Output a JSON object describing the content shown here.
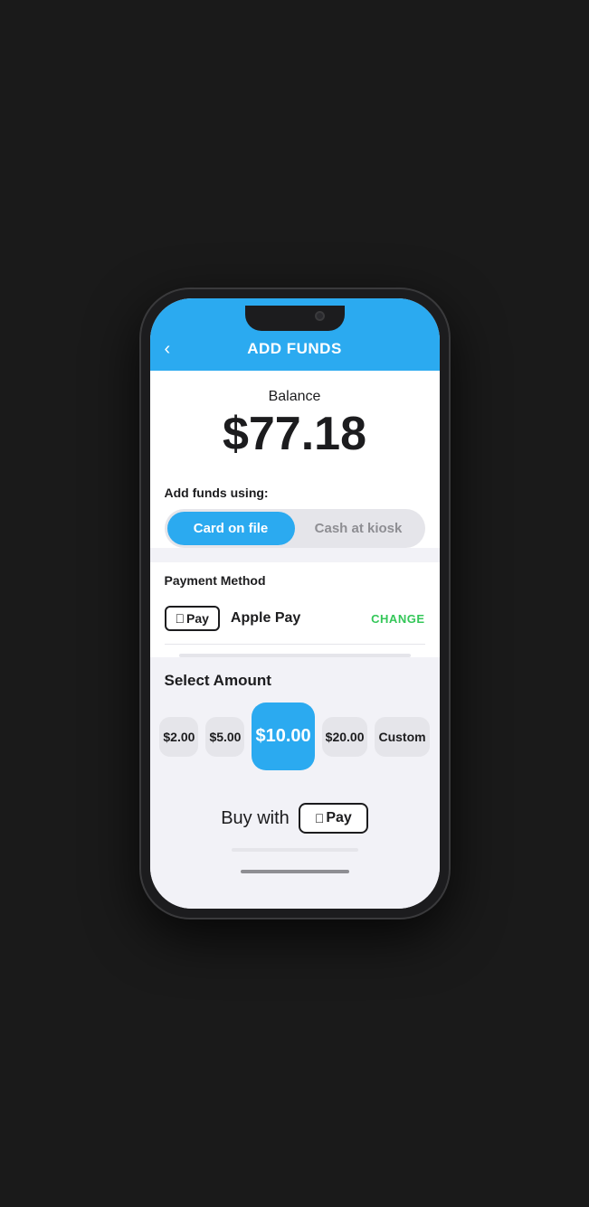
{
  "header": {
    "title": "ADD FUNDS",
    "back_label": "‹"
  },
  "balance": {
    "label": "Balance",
    "amount": "$77.18"
  },
  "add_funds": {
    "label": "Add funds using:",
    "options": [
      {
        "id": "card",
        "label": "Card on file",
        "active": true
      },
      {
        "id": "cash",
        "label": "Cash at kiosk",
        "active": false
      }
    ]
  },
  "payment_method": {
    "label": "Payment Method",
    "name": "Apple Pay",
    "badge_text": "Pay",
    "change_label": "CHANGE"
  },
  "select_amount": {
    "label": "Select Amount",
    "amounts": [
      {
        "id": "2",
        "label": "$2.00",
        "selected": false
      },
      {
        "id": "5",
        "label": "$5.00",
        "selected": false
      },
      {
        "id": "10",
        "label": "$10.00",
        "selected": true
      },
      {
        "id": "20",
        "label": "$20.00",
        "selected": false
      },
      {
        "id": "custom",
        "label": "Custom",
        "selected": false
      }
    ]
  },
  "buy": {
    "label": "Buy with",
    "apple_pay_text": "Pay"
  },
  "colors": {
    "primary": "#2baaf0",
    "text": "#1c1c1e",
    "muted": "#8e8e93",
    "green": "#34c759"
  }
}
